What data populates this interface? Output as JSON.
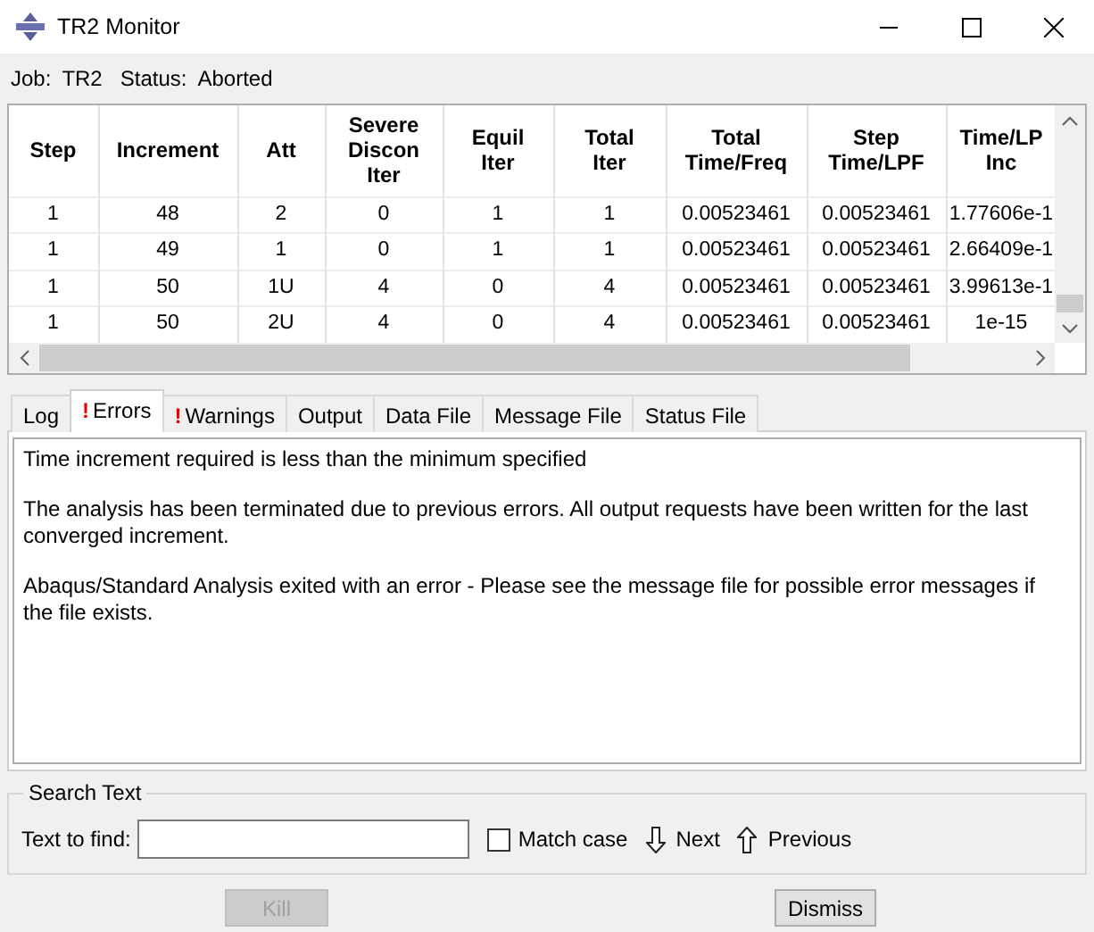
{
  "window": {
    "title": "TR2 Monitor"
  },
  "job": {
    "job_label": "Job:",
    "job": "TR2",
    "status_label": "Status:",
    "status": "Aborted"
  },
  "table": {
    "columns": [
      "Step",
      "Increment",
      "Att",
      "Severe\nDiscon\nIter",
      "Equil\nIter",
      "Total\nIter",
      "Total\nTime/Freq",
      "Step\nTime/LPF",
      "Time/LP\nInc"
    ],
    "rows": [
      [
        "1",
        "48",
        "2",
        "0",
        "1",
        "1",
        "0.00523461",
        "0.00523461",
        "1.77606e-1"
      ],
      [
        "1",
        "49",
        "1",
        "0",
        "1",
        "1",
        "0.00523461",
        "0.00523461",
        "2.66409e-1"
      ],
      [
        "1",
        "50",
        "1U",
        "4",
        "0",
        "4",
        "0.00523461",
        "0.00523461",
        "3.99613e-1"
      ],
      [
        "1",
        "50",
        "2U",
        "4",
        "0",
        "4",
        "0.00523461",
        "0.00523461",
        "1e-15"
      ]
    ]
  },
  "tabs": [
    {
      "label": "Log",
      "selected": false
    },
    {
      "label": "Errors",
      "marker": "!",
      "selected": true
    },
    {
      "label": "Warnings",
      "marker": "!",
      "selected": false
    },
    {
      "label": "Output",
      "selected": false
    },
    {
      "label": "Data File",
      "selected": false
    },
    {
      "label": "Message File",
      "selected": false
    },
    {
      "label": "Status File",
      "selected": false
    }
  ],
  "messages": [
    "Time increment required is less than the minimum specified",
    "The analysis has been terminated due to previous errors. All output requests have been written for the last converged increment.",
    "Abaqus/Standard Analysis exited with an error - Please see the  message file for possible error messages if the file exists."
  ],
  "search": {
    "title": "Search Text",
    "label": "Text to find:",
    "match_case": {
      "label": "Match case",
      "checked": false
    },
    "next": "Next",
    "previous": "Previous"
  },
  "buttons": [
    {
      "label": "Kill",
      "disabled": true
    },
    {
      "label": "Dismiss",
      "disabled": false
    }
  ]
}
